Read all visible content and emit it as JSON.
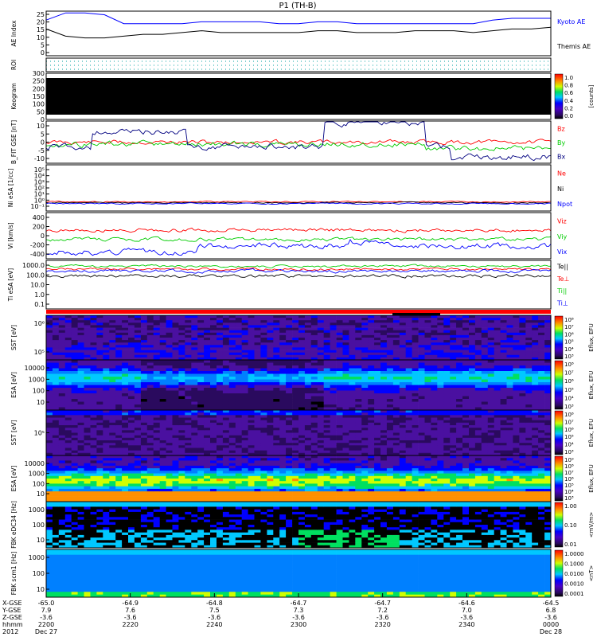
{
  "title": "P1 (TH-B)",
  "colors": {
    "black": "#000000",
    "blue": "#0000ff",
    "green": "#00cc00",
    "red": "#ff0000",
    "navy": "#000080"
  },
  "chart_data": [
    {
      "type": "line",
      "ylabel": "AE Index",
      "ylim": [
        0,
        25
      ],
      "yticks": [
        "25",
        "20",
        "15",
        "10",
        "5",
        "0"
      ],
      "series": [
        {
          "name": "Kyoto AE",
          "color": "#0000ff",
          "values": [
            20,
            24,
            24,
            23,
            18,
            18,
            18,
            18,
            19,
            19,
            19,
            19,
            18,
            18,
            19,
            19,
            18,
            18,
            18,
            18,
            18,
            18,
            18,
            20,
            21,
            21,
            21
          ]
        },
        {
          "name": "Themis AE",
          "color": "#000000",
          "values": [
            15,
            11,
            10,
            10,
            11,
            12,
            12,
            13,
            14,
            13,
            13,
            13,
            13,
            13,
            14,
            14,
            13,
            13,
            13,
            14,
            14,
            14,
            13,
            14,
            15,
            15,
            16
          ]
        }
      ]
    },
    {
      "type": "heatmap",
      "ylabel": "ROI",
      "legend": []
    },
    {
      "type": "heatmap",
      "ylabel": "Keogram",
      "yticks": [
        "300",
        "250",
        "200",
        "150",
        "100",
        "50",
        "0"
      ],
      "colorbar": {
        "label": "[counts]",
        "ticks": [
          "1.0",
          "0.8",
          "0.6",
          "0.4",
          "0.2",
          "0.0"
        ]
      }
    },
    {
      "type": "line",
      "ylabel": "B_FIT GSE [nT]",
      "yticks": [
        "10",
        "5",
        "0",
        "-5",
        "-10"
      ],
      "series": [
        {
          "name": "Bz",
          "color": "#ff0000"
        },
        {
          "name": "By",
          "color": "#00cc00"
        },
        {
          "name": "Bx",
          "color": "#000080"
        }
      ]
    },
    {
      "type": "line",
      "ylabel": "Ni eSA [1/cc]",
      "yticks": [
        "10⁵",
        "10⁴",
        "10³",
        "10²",
        "10¹",
        "10⁰",
        "10⁻¹"
      ],
      "series": [
        {
          "name": "Ne",
          "color": "#ff0000"
        },
        {
          "name": "Ni",
          "color": "#000000"
        },
        {
          "name": "Npot",
          "color": "#0000ff"
        }
      ]
    },
    {
      "type": "line",
      "ylabel": "Vi [km/s]",
      "yticks": [
        "400",
        "200",
        "0",
        "-200",
        "-400"
      ],
      "series": [
        {
          "name": "Viz",
          "color": "#ff0000"
        },
        {
          "name": "Viy",
          "color": "#00cc00"
        },
        {
          "name": "Vix",
          "color": "#0000ff"
        }
      ]
    },
    {
      "type": "line",
      "ylabel": "Ti eSA [eV]",
      "yticks": [
        "1000.0",
        "100.0",
        "10.0",
        "1.0",
        "0.1"
      ],
      "series": [
        {
          "name": "Te||",
          "color": "#000000"
        },
        {
          "name": "Te⊥",
          "color": "#ff0000"
        },
        {
          "name": "Ti||",
          "color": "#00cc00"
        },
        {
          "name": "Ti⊥",
          "color": "#0000ff"
        }
      ]
    },
    {
      "type": "heatmap",
      "ylabel": "SST [eV]",
      "yticks": [
        "10⁶",
        "10⁵"
      ],
      "colorbar": {
        "label": "Eflux, EFU",
        "ticks": [
          "10⁸",
          "10⁷",
          "10⁶",
          "10⁵",
          "10⁴",
          "10³"
        ]
      }
    },
    {
      "type": "heatmap",
      "ylabel": "ESA [eV]",
      "yticks": [
        "10000",
        "1000",
        "100",
        "10"
      ],
      "colorbar": {
        "label": "Eflux, EFU",
        "ticks": [
          "10⁸",
          "10⁷",
          "10⁶",
          "10⁵",
          "10⁴",
          "10³"
        ]
      }
    },
    {
      "type": "heatmap",
      "ylabel": "SST [eV]",
      "yticks": [
        "10⁵"
      ],
      "colorbar": {
        "label": "Eflux, EFU",
        "ticks": [
          "10⁸",
          "10⁷",
          "10⁶",
          "10⁵",
          "10⁴",
          "10³"
        ]
      }
    },
    {
      "type": "heatmap",
      "ylabel": "ESA [eV]",
      "yticks": [
        "10000",
        "1000",
        "100",
        "10"
      ],
      "colorbar": {
        "label": "Eflux, EFU",
        "ticks": [
          "10⁹",
          "10⁸",
          "10⁷",
          "10⁶",
          "10⁵",
          "10⁴",
          "10³"
        ]
      }
    },
    {
      "type": "heatmap",
      "ylabel": "FBK eDC34 [Hz]",
      "yticks": [
        "1000",
        "100",
        "10"
      ],
      "colorbar": {
        "label": "<mV/m>",
        "ticks": [
          "1.00",
          "0.10",
          "0.01"
        ]
      }
    },
    {
      "type": "heatmap",
      "ylabel": "FBK scm1 [Hz]",
      "yticks": [
        "1000",
        "100",
        "10"
      ],
      "colorbar": {
        "label": "<nT>",
        "ticks": [
          "1.0000",
          "0.1000",
          "0.0100",
          "0.0010",
          "0.0001"
        ]
      }
    }
  ],
  "x_axis": {
    "row_labels": [
      "X-GSE",
      "Y-GSE",
      "Z-GSE",
      "hhmm",
      "2012"
    ],
    "columns": [
      {
        "values": [
          "-65.0",
          "7.9",
          "-3.6",
          "2200",
          "Dec 27"
        ]
      },
      {
        "values": [
          "-64.9",
          "7.6",
          "-3.6",
          "2220",
          ""
        ]
      },
      {
        "values": [
          "-64.8",
          "7.5",
          "-3.6",
          "2240",
          ""
        ]
      },
      {
        "values": [
          "-64.7",
          "7.3",
          "-3.6",
          "2300",
          ""
        ]
      },
      {
        "values": [
          "-64.7",
          "7.2",
          "-3.6",
          "2320",
          ""
        ]
      },
      {
        "values": [
          "-64.6",
          "7.0",
          "-3.6",
          "2340",
          ""
        ]
      },
      {
        "values": [
          "-64.5",
          "6.8",
          "-3.6",
          "0000",
          "Dec 28"
        ]
      }
    ]
  }
}
